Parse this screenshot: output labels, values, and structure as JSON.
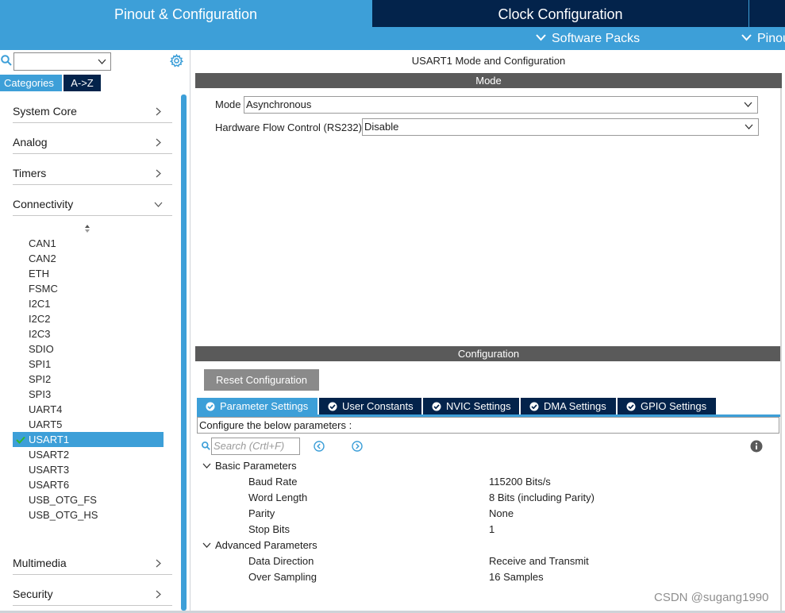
{
  "header": {
    "tabs": [
      "Pinout & Configuration",
      "Clock Configuration",
      ""
    ],
    "submenus": [
      "Software Packs",
      "Pinout"
    ]
  },
  "left_panel": {
    "search_value": "",
    "segments": [
      "Categories",
      "A->Z"
    ],
    "categories_top": [
      "System Core",
      "Analog",
      "Timers",
      "Connectivity"
    ],
    "peripherals": [
      "CAN1",
      "CAN2",
      "ETH",
      "FSMC",
      "I2C1",
      "I2C2",
      "I2C3",
      "SDIO",
      "SPI1",
      "SPI2",
      "SPI3",
      "UART4",
      "UART5",
      "USART1",
      "USART2",
      "USART3",
      "USART6",
      "USB_OTG_FS",
      "USB_OTG_HS"
    ],
    "selected_peripheral": "USART1",
    "categories_bottom": [
      "Multimedia",
      "Security"
    ]
  },
  "mode": {
    "title": "USART1 Mode and Configuration",
    "bar": "Mode",
    "mode_label": "Mode",
    "mode_value": "Asynchronous",
    "flow_label": "Hardware Flow Control (RS232)",
    "flow_value": "Disable"
  },
  "config": {
    "bar": "Configuration",
    "reset_button": "Reset Configuration",
    "tabs": [
      "Parameter Settings",
      "User Constants",
      "NVIC Settings",
      "DMA Settings",
      "GPIO Settings"
    ],
    "active_tab": "Parameter Settings",
    "hint": "Configure the below parameters :",
    "search_placeholder": "Search (Crtl+F)",
    "groups": [
      {
        "name": "Basic Parameters",
        "params": [
          {
            "name": "Baud Rate",
            "value": "115200 Bits/s"
          },
          {
            "name": "Word Length",
            "value": "8 Bits (including Parity)"
          },
          {
            "name": "Parity",
            "value": "None"
          },
          {
            "name": "Stop Bits",
            "value": "1"
          }
        ]
      },
      {
        "name": "Advanced Parameters",
        "params": [
          {
            "name": "Data Direction",
            "value": "Receive and Transmit"
          },
          {
            "name": "Over Sampling",
            "value": "16 Samples"
          }
        ]
      }
    ]
  },
  "watermark": "CSDN @sugang1990",
  "colors": {
    "accent": "#3d9fd8",
    "dark_navy": "#03234b",
    "bar_gray": "#5a5a5a",
    "button_gray": "#8a8a8a",
    "check_green": "#2eb82e"
  }
}
